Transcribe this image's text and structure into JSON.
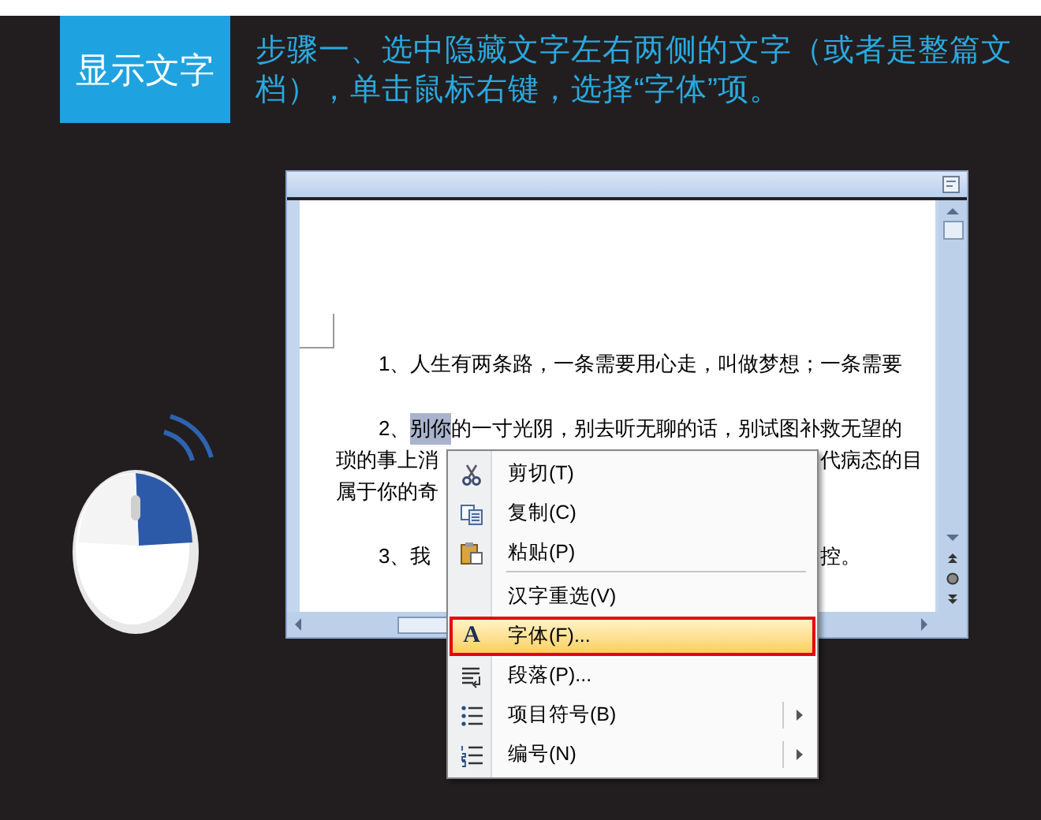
{
  "header": {
    "badge": "显示文字",
    "instruction": "步骤一、选中隐藏文字左右两侧的文字（或者是整篇文档），单击鼠标右键，选择“字体”项。"
  },
  "document": {
    "lines": [
      {
        "indent": true,
        "segments": [
          {
            "text": "1、人生有两条路，一条需要用心走，叫做梦想；一条需要",
            "selected": false
          }
        ]
      },
      {
        "indent": true,
        "segments": [
          {
            "text": "2、",
            "selected": false
          },
          {
            "text": "别你",
            "selected": true
          },
          {
            "text": "的一寸光阴，别去听无聊的话，别试图补救无望的",
            "selected": false
          }
        ]
      },
      {
        "indent": false,
        "segments": [
          {
            "text": "琐的事上消",
            "selected": false
          }
        ],
        "after_menu": "代病态的目"
      },
      {
        "indent": false,
        "segments": [
          {
            "text": "属于你的奇",
            "selected": false
          }
        ]
      },
      {
        "indent": true,
        "segments": [
          {
            "text": "3、我",
            "selected": false
          }
        ],
        "after_menu": "控。"
      }
    ]
  },
  "context_menu": {
    "items": [
      {
        "kind": "scissors",
        "label": "剪切(T)",
        "selected": false,
        "submenu": false,
        "separator_after": false
      },
      {
        "kind": "copy",
        "label": "复制(C)",
        "selected": false,
        "submenu": false,
        "separator_after": false
      },
      {
        "kind": "paste",
        "label": "粘贴(P)",
        "selected": false,
        "submenu": false,
        "separator_after": true
      },
      {
        "kind": "plain",
        "label": "汉字重选(V)",
        "selected": false,
        "submenu": false,
        "separator_after": false
      },
      {
        "kind": "glyph",
        "glyph": "A",
        "label": "字体(F)...",
        "selected": true,
        "submenu": false,
        "separator_after": false
      },
      {
        "kind": "paragraph",
        "label": "段落(P)...",
        "selected": false,
        "submenu": false,
        "separator_after": false
      },
      {
        "kind": "bullets",
        "label": "项目符号(B)",
        "selected": false,
        "submenu": true,
        "separator_after": false
      },
      {
        "kind": "numbering",
        "label": "编号(N)",
        "selected": false,
        "submenu": true,
        "separator_after": false
      }
    ]
  }
}
